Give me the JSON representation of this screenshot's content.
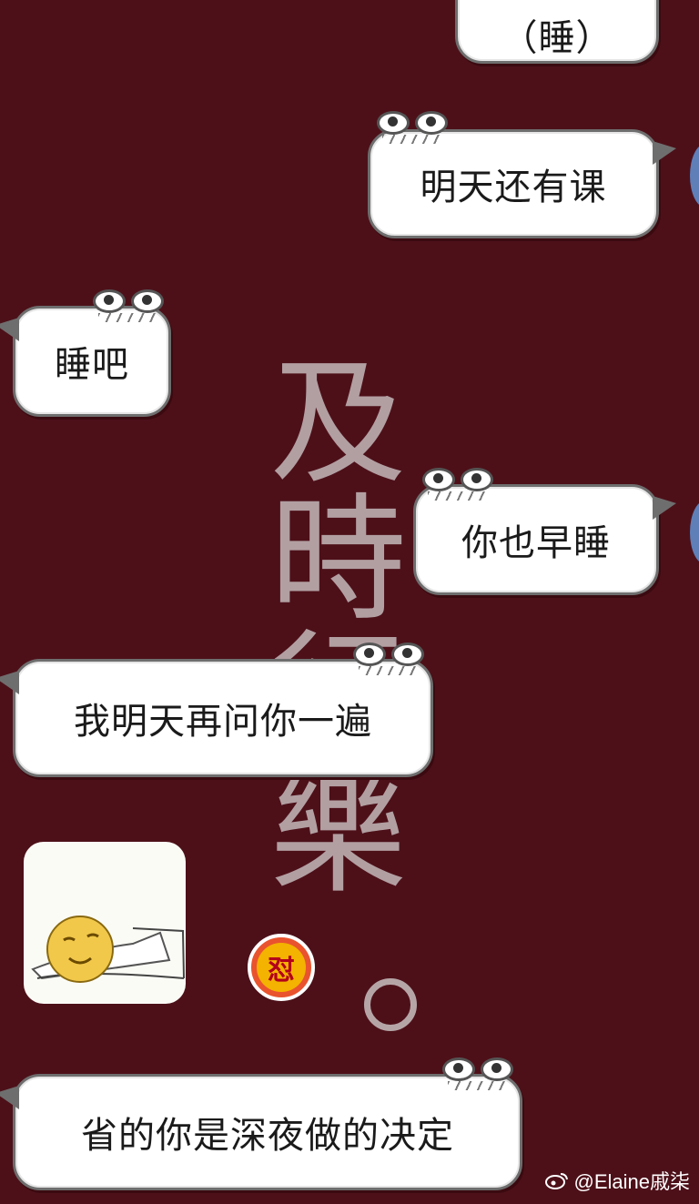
{
  "wallpaper": {
    "text": "及時行樂",
    "mark": "。"
  },
  "messages": [
    {
      "side": "right",
      "text": "（睡）"
    },
    {
      "side": "right",
      "text": "明天还有课"
    },
    {
      "side": "left",
      "text": "睡吧"
    },
    {
      "side": "right",
      "text": "你也早睡"
    },
    {
      "side": "left",
      "text": "我明天再问你一遍"
    },
    {
      "side": "left",
      "type": "sticker",
      "icon": "sleeping-smiley-sticker"
    },
    {
      "side": "left",
      "text": "省的你是深夜做的决定"
    }
  ],
  "badge": {
    "text": "怼"
  },
  "watermark": {
    "text": "@Elaine戚柒",
    "icon": "weibo-icon"
  }
}
